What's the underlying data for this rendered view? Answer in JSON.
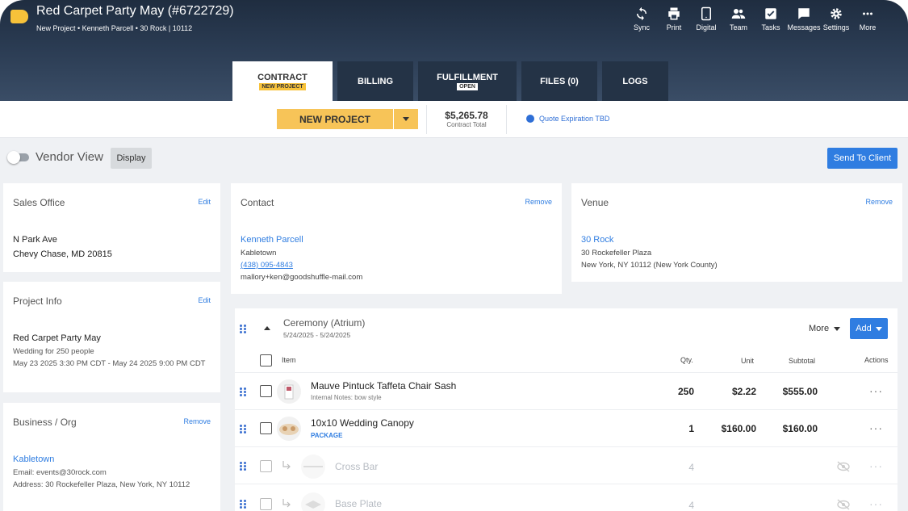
{
  "header": {
    "title": "Red Carpet Party May (#6722729)",
    "subtitle": "New Project • Kenneth Parcell • 30 Rock | 10112",
    "toolbar": [
      {
        "label": "Sync",
        "icon": "sync-icon"
      },
      {
        "label": "Print",
        "icon": "print-icon"
      },
      {
        "label": "Digital",
        "icon": "tablet-icon"
      },
      {
        "label": "Team",
        "icon": "team-icon"
      },
      {
        "label": "Tasks",
        "icon": "tasks-icon"
      },
      {
        "label": "Messages",
        "icon": "messages-icon"
      },
      {
        "label": "Settings",
        "icon": "gear-icon"
      },
      {
        "label": "More",
        "icon": "more-icon"
      }
    ]
  },
  "tabs": [
    {
      "label": "CONTRACT",
      "badge": "NEW PROJECT"
    },
    {
      "label": "BILLING",
      "badge": ""
    },
    {
      "label": "FULFILLMENT",
      "badge": "OPEN"
    },
    {
      "label": "FILES (0)",
      "badge": ""
    },
    {
      "label": "LOGS",
      "badge": ""
    }
  ],
  "status": {
    "label": "NEW PROJECT",
    "total_amount": "$5,265.78",
    "total_label": "Contract Total",
    "quote": "Quote Expiration TBD"
  },
  "vendor": {
    "toggle_label": "Vendor View",
    "display_label": "Display",
    "send_label": "Send To Client"
  },
  "sales_office": {
    "title": "Sales Office",
    "action": "Edit",
    "line1": "N Park Ave",
    "line2": "Chevy Chase, MD 20815"
  },
  "project_info": {
    "title": "Project Info",
    "action": "Edit",
    "name": "Red Carpet Party May",
    "desc": "Wedding for 250 people",
    "dates": "May 23 2025 3:30 PM CDT - May 24 2025 9:00 PM CDT"
  },
  "business": {
    "title": "Business / Org",
    "action": "Remove",
    "name": "Kabletown",
    "email": "Email: events@30rock.com",
    "address": "Address: 30 Rockefeller Plaza, New York, NY 10112"
  },
  "contact": {
    "title": "Contact",
    "action": "Remove",
    "name": "Kenneth Parcell",
    "company": "Kabletown",
    "phone": "(438) 095-4843",
    "email": "mallory+ken@goodshuffle-mail.com"
  },
  "venue": {
    "title": "Venue",
    "action": "Remove",
    "name": "30 Rock",
    "street": "30 Rockefeller Plaza",
    "city": "New York, NY 10112 (New York County)"
  },
  "section": {
    "name": "Ceremony (Atrium)",
    "dates": "5/24/2025 - 5/24/2025",
    "more_label": "More",
    "add_label": "Add",
    "columns": {
      "item": "Item",
      "qty": "Qty.",
      "unit": "Unit",
      "subtotal": "Subtotal",
      "actions": "Actions"
    },
    "rows": [
      {
        "name": "Mauve Pintuck Taffeta Chair Sash",
        "sub": "Internal Notes: bow style",
        "qty": "250",
        "unit": "$2.22",
        "subtotal": "$555.00"
      },
      {
        "name": "10x10 Wedding Canopy",
        "sub": "PACKAGE",
        "qty": "1",
        "unit": "$160.00",
        "subtotal": "$160.00"
      },
      {
        "name": "Cross Bar",
        "sub": "",
        "qty": "4",
        "unit": "",
        "subtotal": ""
      },
      {
        "name": "Base Plate",
        "sub": "",
        "qty": "4",
        "unit": "",
        "subtotal": ""
      }
    ]
  }
}
